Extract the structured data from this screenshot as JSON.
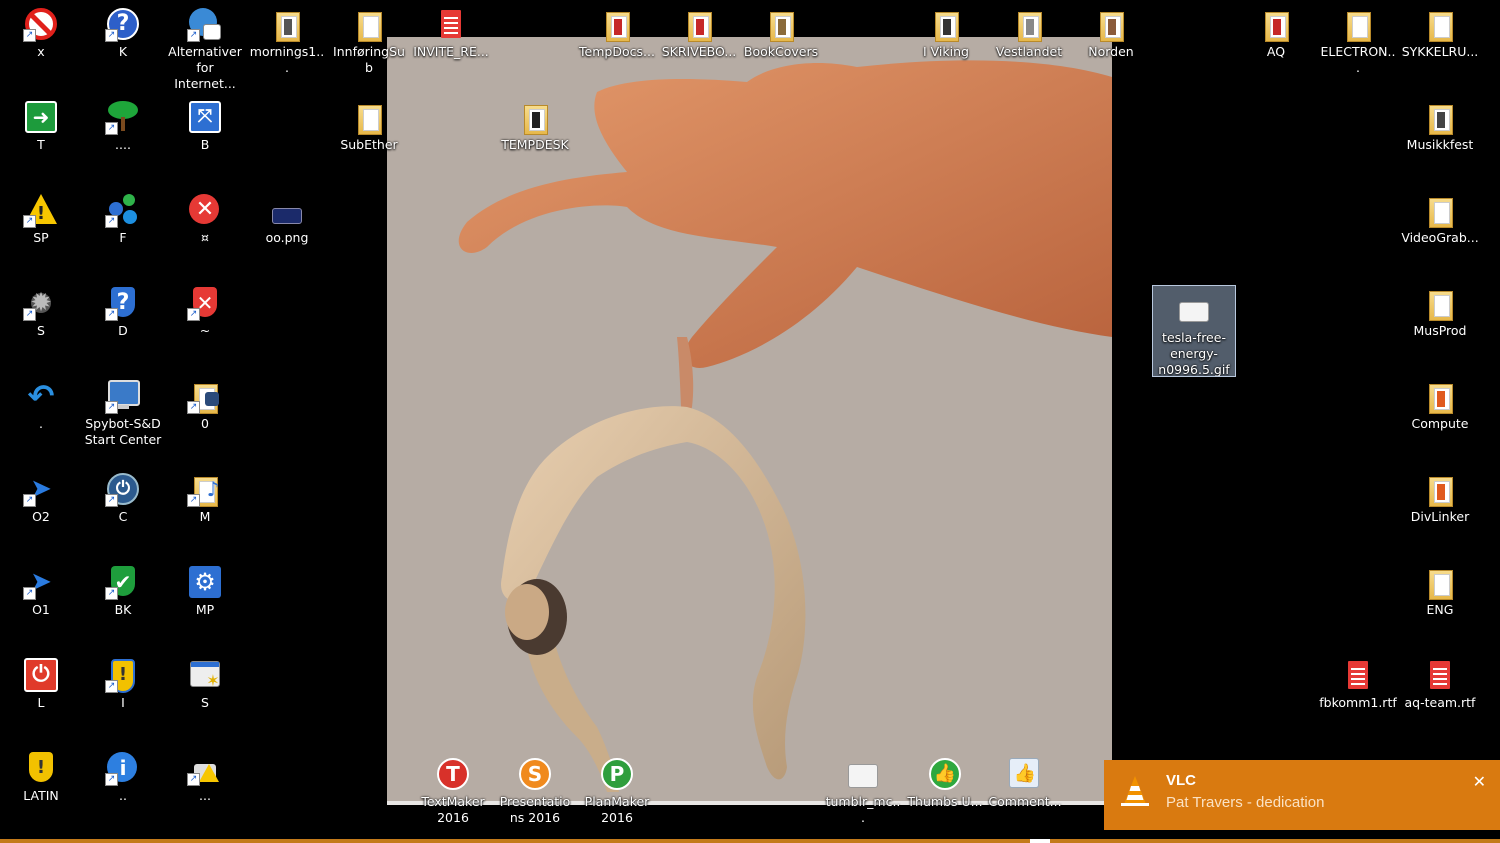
{
  "desktop": {
    "icons": {
      "x": "x",
      "k": "K",
      "alternativer": "Alternativer for Internet...",
      "mornings": "mornings1...",
      "innforing": "InnføringSub",
      "invite": "INVITE_RE...",
      "tempdocs": "TempDocs...",
      "skrivebo": "SKRIVEBO...",
      "bookcovers": "BookCovers",
      "iviking": "I Viking",
      "vestlandet": "Vestlandet",
      "norden": "Norden",
      "aq": "AQ",
      "electron": "ELECTRON...",
      "sykkelru": "SYKKELRU...",
      "t": "T",
      "dots4": "....",
      "b": "B",
      "subether": "SubEther",
      "tempdesk": "TEMPDESK",
      "musikkfest": "Musikkfest",
      "sp": "SP",
      "f": "F",
      "currency": "¤",
      "oo_png": "oo.png",
      "videograb": "VideoGrab...",
      "s1": "S",
      "d": "D",
      "tilde": "~",
      "tesla_gif": "tesla-free-energy-n0996.5.gif",
      "musprod": "MusProd",
      "dot": ".",
      "spybot": "Spybot-S&D Start Center",
      "zero": "0",
      "compute": "Compute",
      "o2": "O2",
      "c": "C",
      "m": "M",
      "divlinker": "DivLinker",
      "o1": "O1",
      "bk": "BK",
      "mp": "MP",
      "eng": "ENG",
      "l": "L",
      "i": "I",
      "s2": "S",
      "fbkomm": "fbkomm1.rtf",
      "aqteam": "aq-team.rtf",
      "latin": "LATIN",
      "dots2": "..",
      "dots3": "...",
      "textmaker": "TextMaker 2016",
      "presentations": "Presentations 2016",
      "planmaker": "PlanMaker 2016",
      "tumblr": "tumblr_mc...",
      "thumbs": "Thumbs U...",
      "comment": "Comment..."
    }
  },
  "notification": {
    "app": "VLC",
    "track": "Pat Travers - dedication",
    "close": "✕"
  }
}
